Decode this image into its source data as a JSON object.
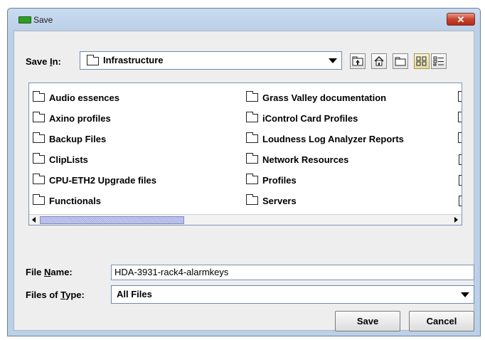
{
  "window": {
    "title": "Save",
    "close_label": "✕"
  },
  "save_in": {
    "label_prefix": "Save ",
    "label_underlined": "I",
    "label_suffix": "n:",
    "selected": "Infrastructure"
  },
  "toolbar": {
    "up_icon": "up-folder-icon",
    "home_icon": "home-icon",
    "new_folder_icon": "new-folder-icon",
    "list_view_icon": "list-view-icon",
    "details_view_icon": "details-view-icon",
    "active_view": "list"
  },
  "files": {
    "column1": [
      "Audio essences",
      "Axino profiles",
      "Backup Files",
      "ClipLists",
      "CPU-ETH2 Upgrade files",
      "Functionals"
    ],
    "column2": [
      "Grass Valley documentation",
      "iControl Card Profiles",
      "Loudness Log Analyzer Reports",
      "Network Resources",
      "Profiles",
      "Servers"
    ],
    "column3_types": [
      "folder",
      "folder",
      "folder",
      "doc",
      "doc",
      "doc"
    ]
  },
  "file_name": {
    "label_prefix": "File ",
    "label_underlined": "N",
    "label_suffix": "ame:",
    "value": "HDA-3931-rack4-alarmkeys"
  },
  "file_type": {
    "label_prefix": "Files of ",
    "label_underlined": "T",
    "label_suffix": "ype:",
    "selected": "All Files"
  },
  "buttons": {
    "save": "Save",
    "cancel": "Cancel"
  },
  "colors": {
    "close_button": "#c8432e",
    "title_icon": "#2f9d21",
    "scroll_thumb": "#a9b1e6"
  }
}
